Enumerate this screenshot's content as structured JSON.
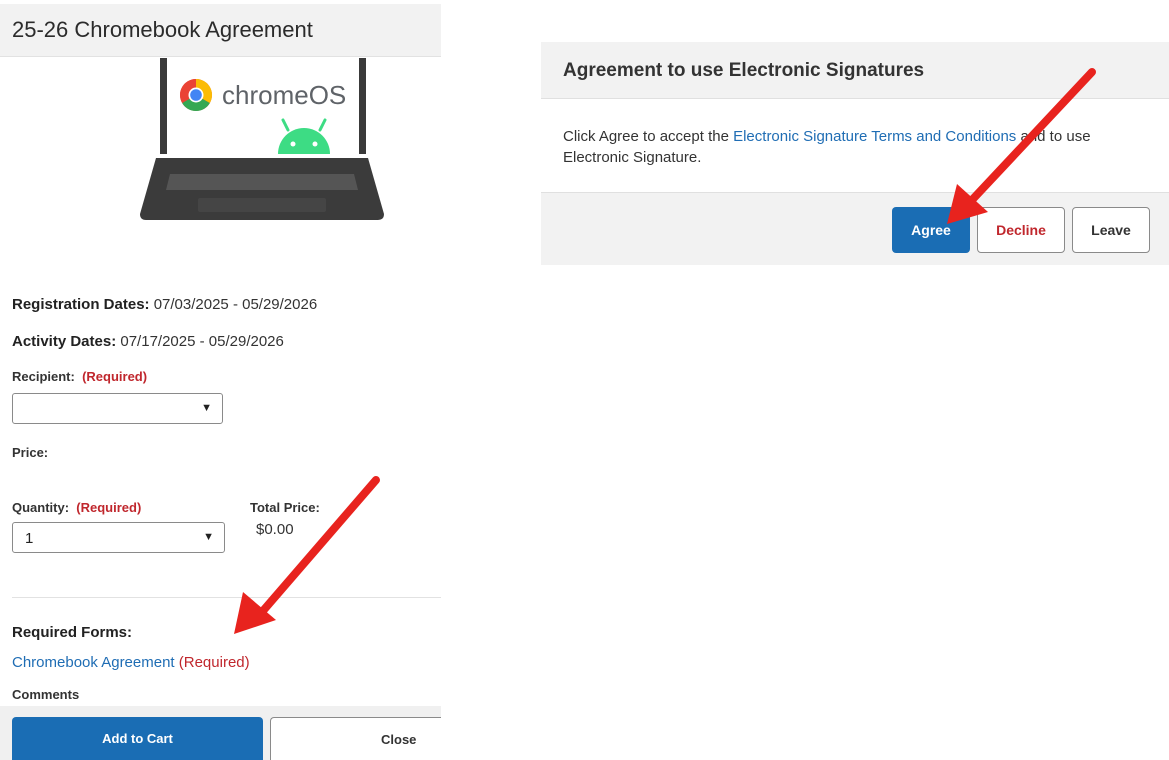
{
  "left": {
    "title": "25-26 Chromebook Agreement",
    "laptop_brand": "chromeOS",
    "registration_label": "Registration Dates:",
    "registration_value": "07/03/2025 - 05/29/2026",
    "activity_label": "Activity Dates:",
    "activity_value": "07/17/2025 - 05/29/2026",
    "recipient_label": "Recipient:",
    "recipient_required": "(Required)",
    "recipient_value": "",
    "price_label": "Price:",
    "quantity_label": "Quantity:",
    "quantity_required": "(Required)",
    "quantity_value": "1",
    "total_price_label": "Total Price:",
    "total_price_value": "$0.00",
    "required_forms_label": "Required Forms:",
    "form_link": "Chromebook Agreement",
    "form_required": "(Required)",
    "comments_label": "Comments",
    "add_to_cart": "Add to Cart",
    "close": "Close"
  },
  "dialog": {
    "title": "Agreement to use Electronic Signatures",
    "body_pre": "Click Agree to accept the ",
    "body_link": "Electronic Signature Terms and Conditions",
    "body_post": " and to use Electronic Signature.",
    "agree": "Agree",
    "decline": "Decline",
    "leave": "Leave"
  },
  "colors": {
    "primary": "#1a6db4",
    "link": "#1f6db4",
    "required": "#c0272d",
    "arrow": "#e8231e",
    "header_bg": "#f2f2f2"
  },
  "icons": [
    "chromeos-laptop-illustration",
    "chrome-logo-icon",
    "android-icon",
    "caret-down-icon",
    "annotation-arrow-icon"
  ]
}
